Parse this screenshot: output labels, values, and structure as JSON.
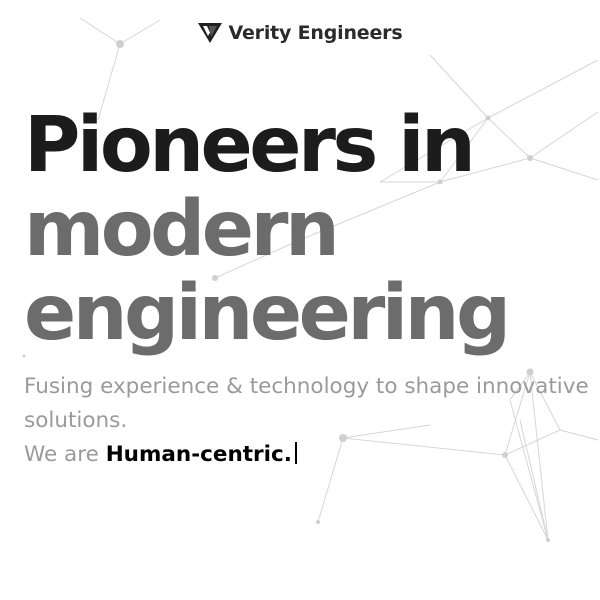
{
  "brand": {
    "name": "Verity Engineers",
    "logo_icon": "v-logo-icon"
  },
  "hero": {
    "headline_line1": "Pioneers in",
    "headline_line2": "modern",
    "headline_line3": "engineering",
    "tagline_line1": "Fusing experience & technology to shape innovative",
    "tagline_line2": "solutions.",
    "typed_prefix": "We are",
    "typed_word": "Human-centric."
  },
  "colors": {
    "headline_dark": "#1c1c1c",
    "headline_gray": "#6c6c6c",
    "tagline_gray": "#9a9a9a",
    "emphasis": "#000000"
  }
}
